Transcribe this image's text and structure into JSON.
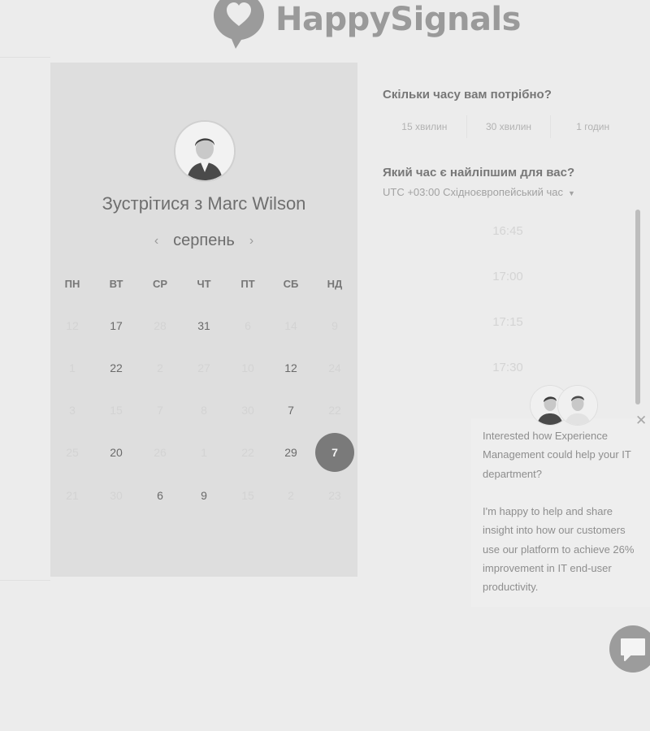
{
  "brand": {
    "name": "HappySignals"
  },
  "left_panel": {
    "title": "Зустрітися з Marc Wilson",
    "month": "серпень",
    "weekdays": [
      "ПН",
      "ВТ",
      "СР",
      "ЧТ",
      "ПТ",
      "СБ",
      "НД"
    ],
    "weeks": [
      [
        {
          "d": "12",
          "active": false
        },
        {
          "d": "17",
          "active": true
        },
        {
          "d": "28",
          "active": false
        },
        {
          "d": "31",
          "active": true
        },
        {
          "d": "6",
          "active": false
        },
        {
          "d": "14",
          "active": false
        },
        {
          "d": "9",
          "active": false
        }
      ],
      [
        {
          "d": "1",
          "active": false
        },
        {
          "d": "22",
          "active": true
        },
        {
          "d": "2",
          "active": false
        },
        {
          "d": "27",
          "active": false
        },
        {
          "d": "10",
          "active": false
        },
        {
          "d": "12",
          "active": true
        },
        {
          "d": "24",
          "active": false
        }
      ],
      [
        {
          "d": "3",
          "active": false
        },
        {
          "d": "15",
          "active": false
        },
        {
          "d": "7",
          "active": false
        },
        {
          "d": "8",
          "active": false
        },
        {
          "d": "30",
          "active": false
        },
        {
          "d": "7",
          "active": true
        },
        {
          "d": "22",
          "active": false
        }
      ],
      [
        {
          "d": "25",
          "active": false
        },
        {
          "d": "20",
          "active": true
        },
        {
          "d": "26",
          "active": false
        },
        {
          "d": "1",
          "active": false
        },
        {
          "d": "22",
          "active": false
        },
        {
          "d": "29",
          "active": true
        },
        {
          "d": "7",
          "active": true,
          "selected": true
        }
      ],
      [
        {
          "d": "21",
          "active": false
        },
        {
          "d": "30",
          "active": false
        },
        {
          "d": "6",
          "active": true
        },
        {
          "d": "9",
          "active": true
        },
        {
          "d": "15",
          "active": false
        },
        {
          "d": "2",
          "active": false
        },
        {
          "d": "23",
          "active": false
        }
      ]
    ]
  },
  "right_panel": {
    "duration_title": "Скільки часу вам потрібно?",
    "durations": [
      "15 хвилин",
      "30 хвилин",
      "1 годин"
    ],
    "time_title": "Який час є найліпшим для вас?",
    "timezone": "UTC +03:00 Східноєвропейський час",
    "slots": [
      "16:45",
      "17:00",
      "17:15",
      "17:30"
    ]
  },
  "chat": {
    "line1": "Interested how Experience",
    "line2": "Management could help your IT",
    "line3": "department?",
    "line4": "I'm happy to help and share",
    "line5": "insight into how our customers",
    "line6": "use our platform to achieve 26%",
    "line7": "improvement in IT end-user",
    "line8": "productivity.",
    "close_glyph": "✕"
  },
  "colors": {
    "page_bg": "#ececec",
    "panel_bg": "#dedede",
    "selected_day": "#7a7a7a",
    "text_active": "#6a6a6a",
    "text_inactive": "#d3d3d3"
  }
}
